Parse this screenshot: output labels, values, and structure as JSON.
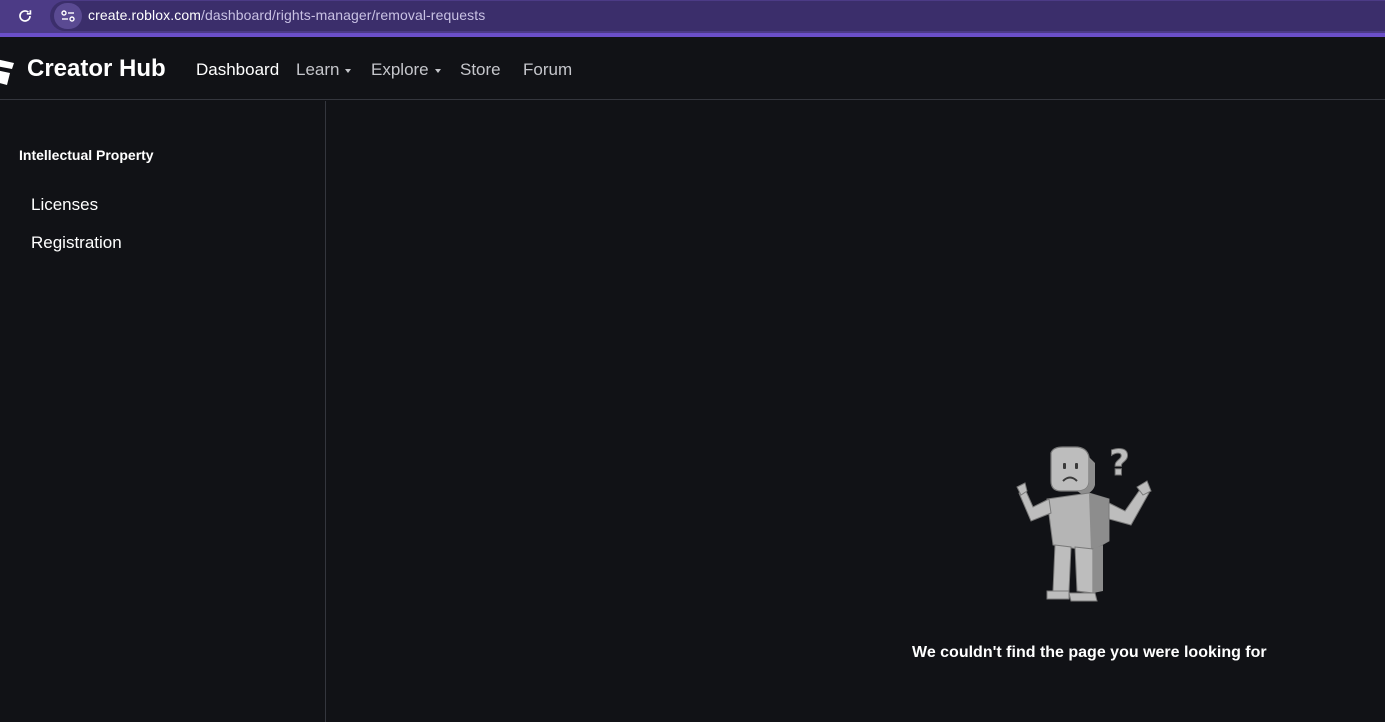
{
  "browser": {
    "url_host": "create.roblox.com",
    "url_path": "/dashboard/rights-manager/removal-requests",
    "reload_icon": "reload-icon",
    "site_info_icon": "site-settings-icon",
    "accent_color": "#4c3b86"
  },
  "header": {
    "brand": "Creator Hub",
    "nav": [
      {
        "label": "Dashboard",
        "active": true,
        "dropdown": false
      },
      {
        "label": "Learn",
        "active": false,
        "dropdown": true
      },
      {
        "label": "Explore",
        "active": false,
        "dropdown": true
      },
      {
        "label": "Store",
        "active": false,
        "dropdown": false
      },
      {
        "label": "Forum",
        "active": false,
        "dropdown": false
      }
    ]
  },
  "sidebar": {
    "heading": "Intellectual Property",
    "items": [
      {
        "label": "Licenses"
      },
      {
        "label": "Registration"
      }
    ]
  },
  "main": {
    "message": "We couldn't find the page you were looking for",
    "illustration": "confused-robloxian-icon"
  },
  "colors": {
    "background": "#111216",
    "border": "#34363d",
    "text": "#ffffff",
    "muted_text": "#c5c6cb"
  }
}
